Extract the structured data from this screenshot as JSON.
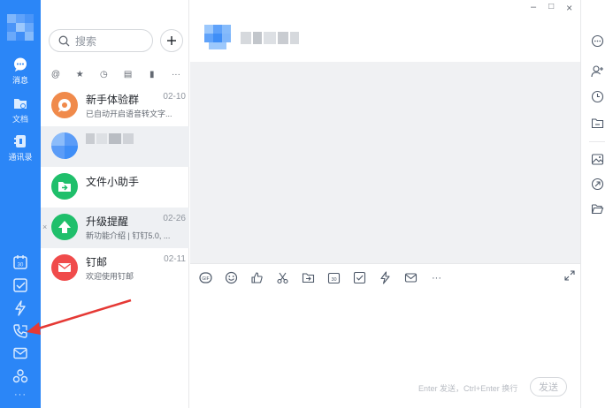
{
  "window": {
    "minimize": "–",
    "maximize": "□",
    "close": "×"
  },
  "rail": {
    "items": [
      {
        "label": "消息",
        "icon": "chat-bubble-icon"
      },
      {
        "label": "文档",
        "icon": "folder-doc-icon"
      },
      {
        "label": "通讯录",
        "icon": "contacts-icon"
      }
    ],
    "bottom": [
      {
        "icon": "calendar-icon",
        "text": "30"
      },
      {
        "icon": "todo-check-icon"
      },
      {
        "icon": "lightning-icon"
      },
      {
        "icon": "phone-call-icon"
      },
      {
        "icon": "mail-icon"
      },
      {
        "icon": "apps-cluster-icon"
      },
      {
        "icon": "more-dots-icon"
      }
    ]
  },
  "search": {
    "placeholder": "搜索"
  },
  "filters": [
    "@",
    "★",
    "◷",
    "▤",
    "▮",
    "···"
  ],
  "conversations": [
    {
      "name": "新手体验群",
      "date": "02-10",
      "preview": "已自动开启语音转文字...",
      "avatar_color": "#f08a4b"
    },
    {
      "name": "",
      "date": "",
      "preview": "",
      "avatar_color": "#5b9cf7"
    },
    {
      "name": "文件小助手",
      "date": "",
      "preview": "",
      "avatar_color": "#1fbf6b"
    },
    {
      "name": "升级提醒",
      "date": "02-26",
      "preview": "新功能介绍 | 钉钉5.0, ...",
      "avatar_color": "#1fbf6b",
      "close": "×"
    },
    {
      "name": "钉邮",
      "date": "02-11",
      "preview": "欢迎使用钉邮",
      "avatar_color": "#f04b4b"
    }
  ],
  "toolbar": {
    "tools": [
      "gif-icon",
      "emoji-icon",
      "thumbs-up-icon",
      "scissors-icon",
      "folder-send-icon",
      "calendar-icon",
      "todo-check-icon",
      "lightning-icon",
      "mail-icon",
      "more-dots-icon"
    ],
    "gif_text": "GIF",
    "cal_text": "30",
    "more_text": "···"
  },
  "composer": {
    "hint": "Enter 发送，Ctrl+Enter 换行",
    "send_label": "发送"
  },
  "right_panel": [
    "more-circle-icon",
    "add-member-icon",
    "history-clock-icon",
    "folder-icon",
    "image-icon",
    "link-icon",
    "open-folder-icon"
  ],
  "colors": {
    "rail": "#2b86f7",
    "accent": "#2b86f7",
    "arrow": "#e53935"
  }
}
